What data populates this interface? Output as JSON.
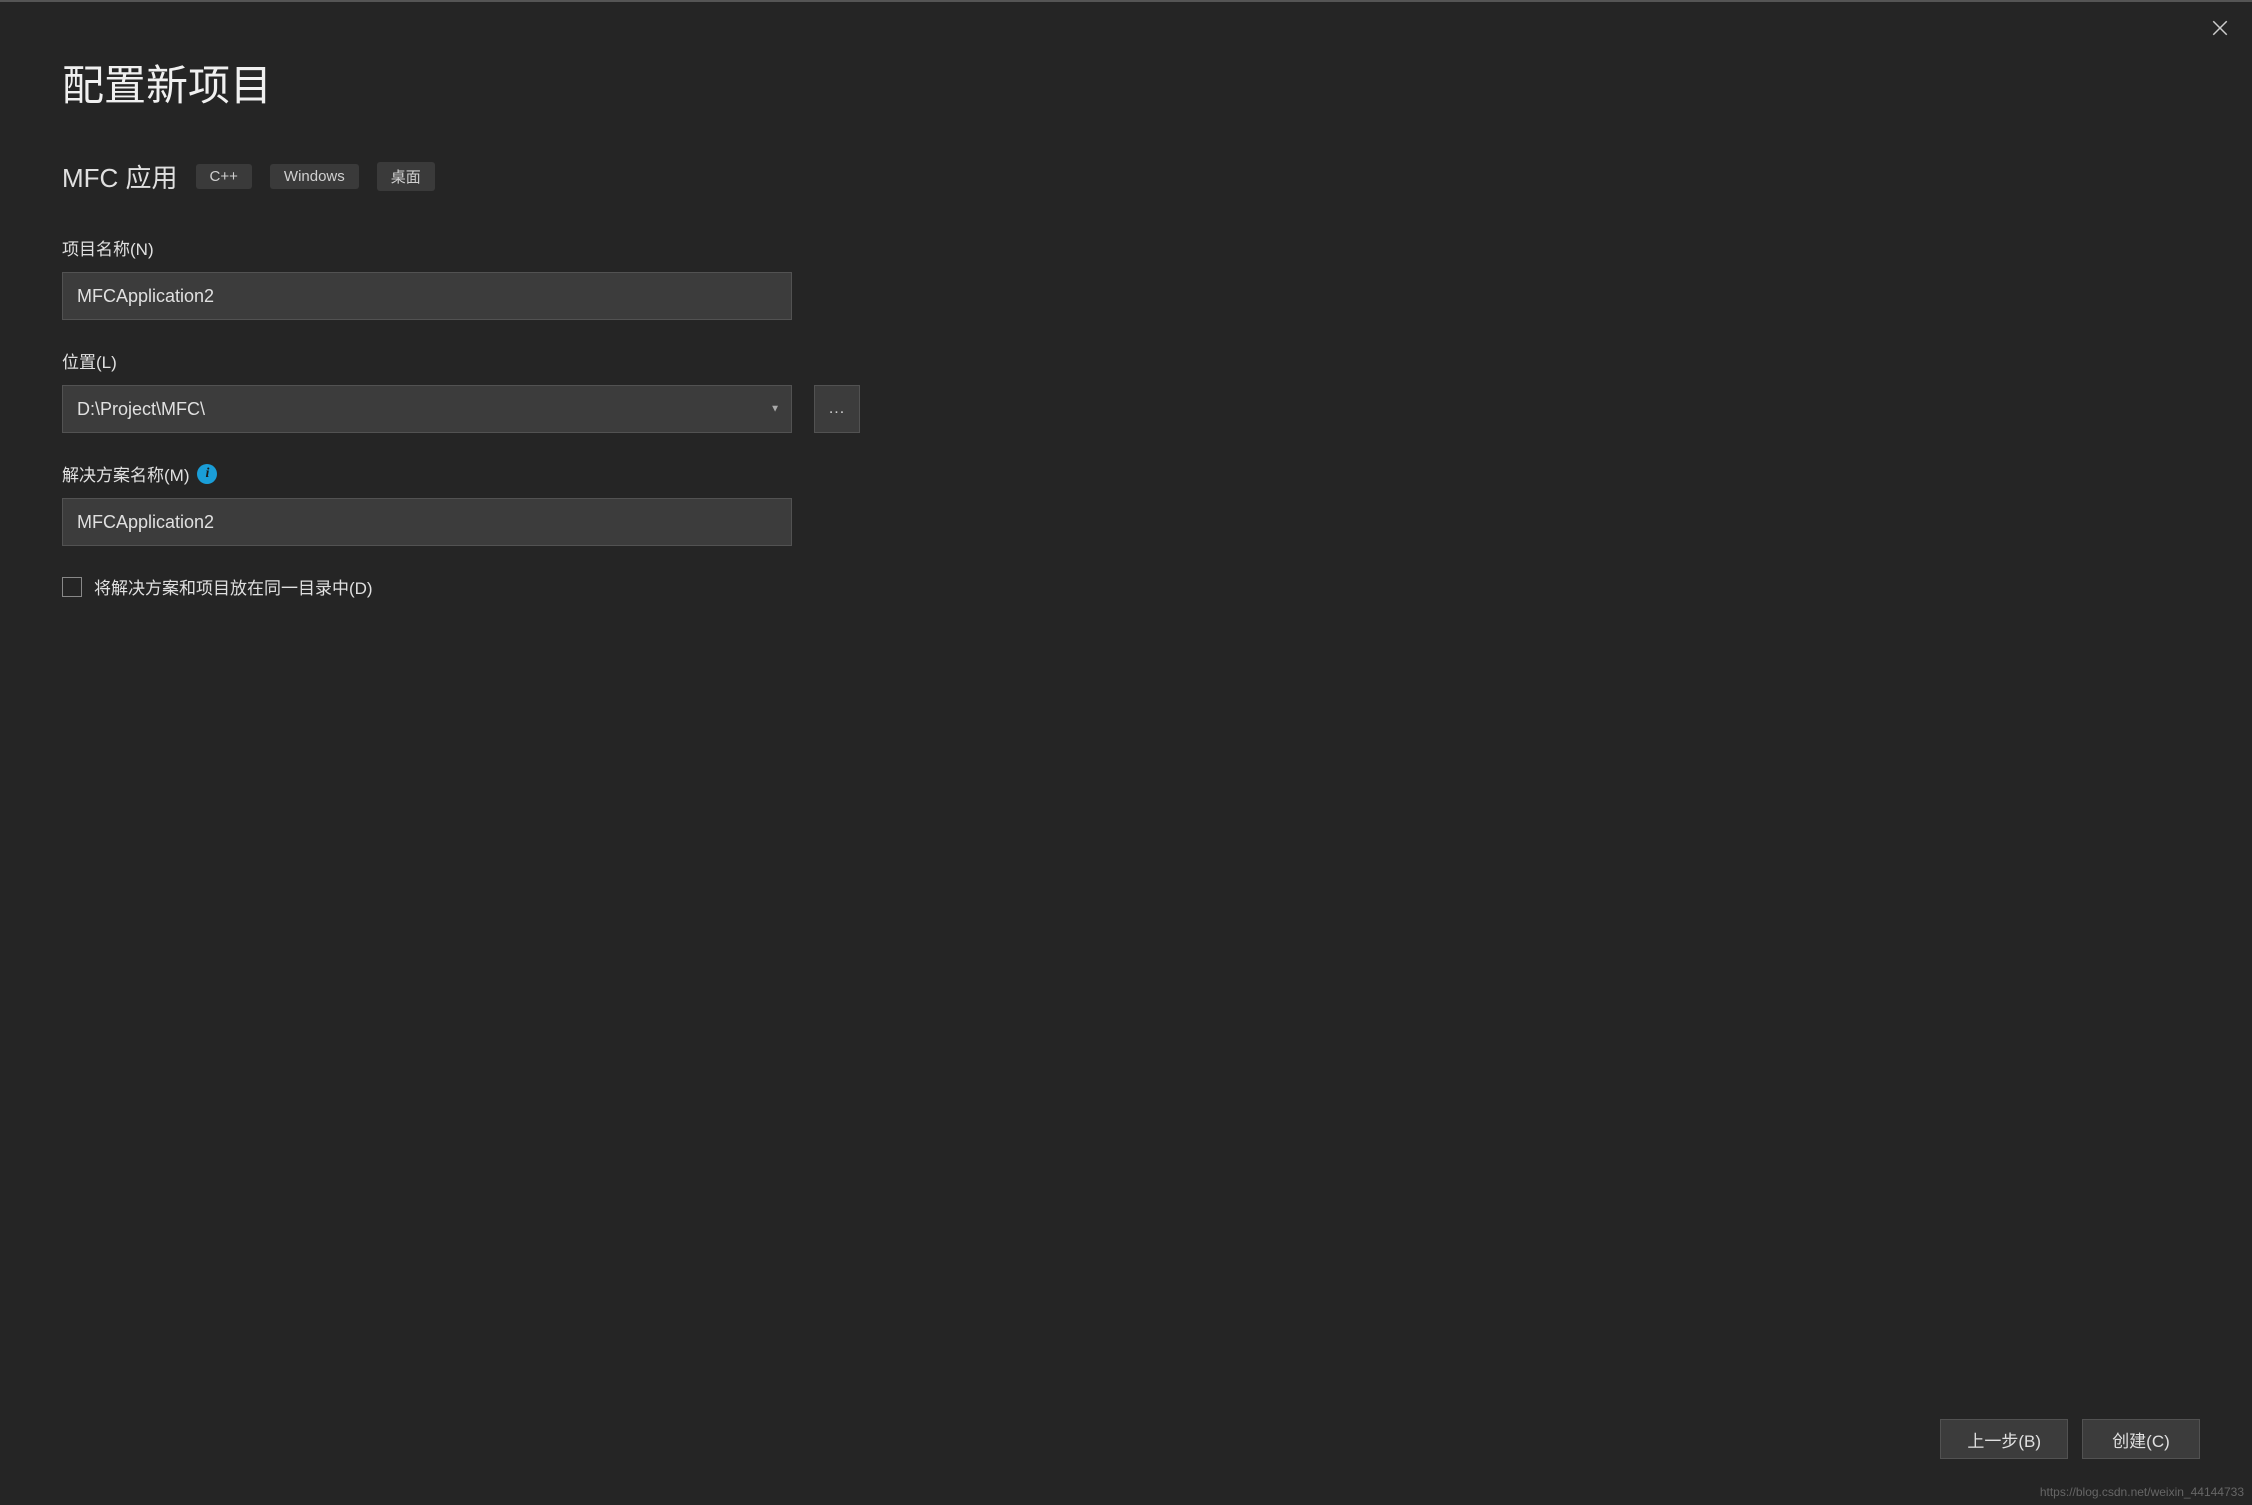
{
  "header": {
    "title": "配置新项目"
  },
  "template": {
    "name": "MFC 应用",
    "tags": [
      "C++",
      "Windows",
      "桌面"
    ]
  },
  "fields": {
    "project_name": {
      "label": "项目名称(N)",
      "value": "MFCApplication2"
    },
    "location": {
      "label": "位置(L)",
      "value": "D:\\Project\\MFC\\",
      "browse_label": "..."
    },
    "solution_name": {
      "label": "解决方案名称(M)",
      "value": "MFCApplication2"
    },
    "same_dir_checkbox": {
      "label": "将解决方案和项目放在同一目录中(D)",
      "checked": false
    }
  },
  "footer": {
    "back_label": "上一步(B)",
    "create_label": "创建(C)"
  },
  "watermark": "https://blog.csdn.net/weixin_44144733"
}
